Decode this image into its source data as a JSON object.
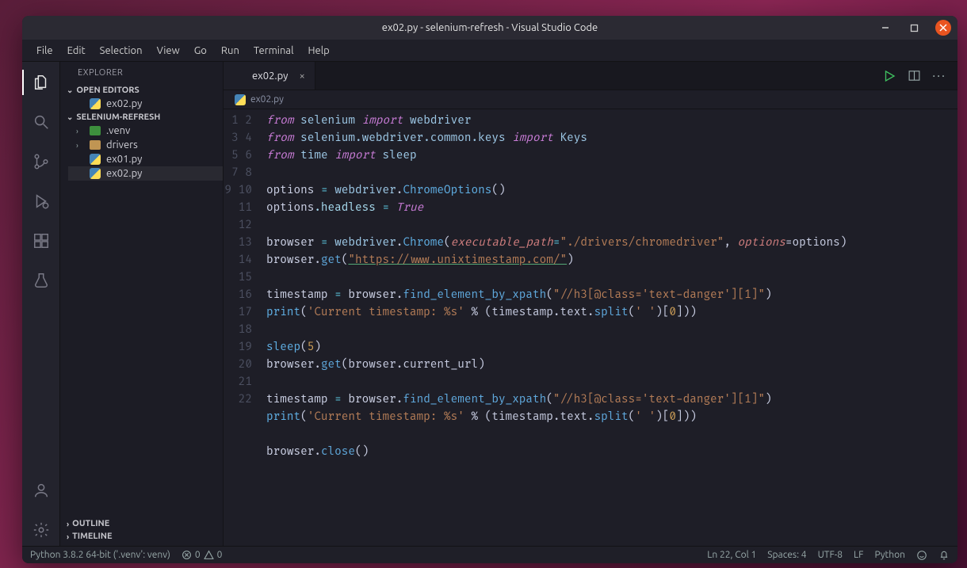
{
  "title": "ex02.py - selenium-refresh - Visual Studio Code",
  "menu": [
    "File",
    "Edit",
    "Selection",
    "View",
    "Go",
    "Run",
    "Terminal",
    "Help"
  ],
  "activity_icons": [
    "files-icon",
    "search-icon",
    "source-control-icon",
    "run-debug-icon",
    "extensions-icon",
    "test-icon"
  ],
  "activity_bottom": [
    "account-icon",
    "settings-icon"
  ],
  "sidebar": {
    "title": "EXPLORER",
    "open_editors_label": "OPEN EDITORS",
    "open_editors": [
      {
        "label": "ex02.py"
      }
    ],
    "project_label": "SELENIUM-REFRESH",
    "tree": [
      {
        "kind": "folder",
        "label": ".venv",
        "chev": "›",
        "folder": "green"
      },
      {
        "kind": "folder",
        "label": "drivers",
        "chev": "›",
        "folder": "tan"
      },
      {
        "kind": "file",
        "label": "ex01.py"
      },
      {
        "kind": "file",
        "label": "ex02.py",
        "selected": true
      }
    ],
    "outline_label": "OUTLINE",
    "timeline_label": "TIMELINE"
  },
  "tab": {
    "label": "ex02.py"
  },
  "breadcrumb": {
    "label": "ex02.py"
  },
  "code": {
    "lines": 22
  },
  "status": {
    "python": "Python 3.8.2 64-bit ('.venv': venv)",
    "problems": "0",
    "warnings": "0",
    "ln_col": "Ln 22, Col 1",
    "spaces": "Spaces: 4",
    "encoding": "UTF-8",
    "eol": "LF",
    "lang": "Python"
  },
  "source": {
    "l1": {
      "a": "from",
      "b": "selenium",
      "c": "import",
      "d": "webdriver"
    },
    "l2": {
      "a": "from",
      "b": "selenium.webdriver.common.keys",
      "c": "import",
      "d": "Keys"
    },
    "l3": {
      "a": "from",
      "b": "time",
      "c": "import",
      "d": "sleep"
    },
    "l5": {
      "a": "options",
      "b": "=",
      "c": "webdriver",
      "d": ".",
      "e": "ChromeOptions",
      "f": "()"
    },
    "l6": {
      "a": "options",
      "b": ".headless",
      "c": " = ",
      "d": "True"
    },
    "l8": {
      "a": "browser",
      "b": " = ",
      "c": "webdriver",
      "d": ".",
      "e": "Chrome",
      "f": "(",
      "g": "executable_path",
      "h": "=",
      "i": "\"./drivers/chromedriver\"",
      "j": ", ",
      "k": "options",
      "l": "=options)"
    },
    "l9": {
      "a": "browser",
      "b": ".",
      "c": "get",
      "d": "(",
      "e": "\"https://www.unixtimestamp.com/\"",
      "f": ")"
    },
    "l11": {
      "a": "timestamp",
      "b": " = ",
      "c": "browser",
      "d": ".",
      "e": "find_element_by_xpath",
      "f": "(",
      "g": "\"//h3[@class='text-danger'][1]\"",
      "h": ")"
    },
    "l12": {
      "a": "print",
      "b": "(",
      "c": "'Current timestamp: %s'",
      "d": " % (timestamp.text.",
      "e": "split",
      "f": "(",
      "g": "' '",
      "h": ")[",
      "i": "0",
      "j": "]))"
    },
    "l14": {
      "a": "sleep",
      "b": "(",
      "c": "5",
      "d": ")"
    },
    "l15": {
      "a": "browser",
      "b": ".",
      "c": "get",
      "d": "(browser.current_url)"
    },
    "l17": {
      "a": "timestamp",
      "b": " = ",
      "c": "browser",
      "d": ".",
      "e": "find_element_by_xpath",
      "f": "(",
      "g": "\"//h3[@class='text-danger'][1]\"",
      "h": ")"
    },
    "l18": {
      "a": "print",
      "b": "(",
      "c": "'Current timestamp: %s'",
      "d": " % (timestamp.text.",
      "e": "split",
      "f": "(",
      "g": "' '",
      "h": ")[",
      "i": "0",
      "j": "]))"
    },
    "l20": {
      "a": "browser",
      "b": ".",
      "c": "close",
      "d": "()"
    }
  }
}
